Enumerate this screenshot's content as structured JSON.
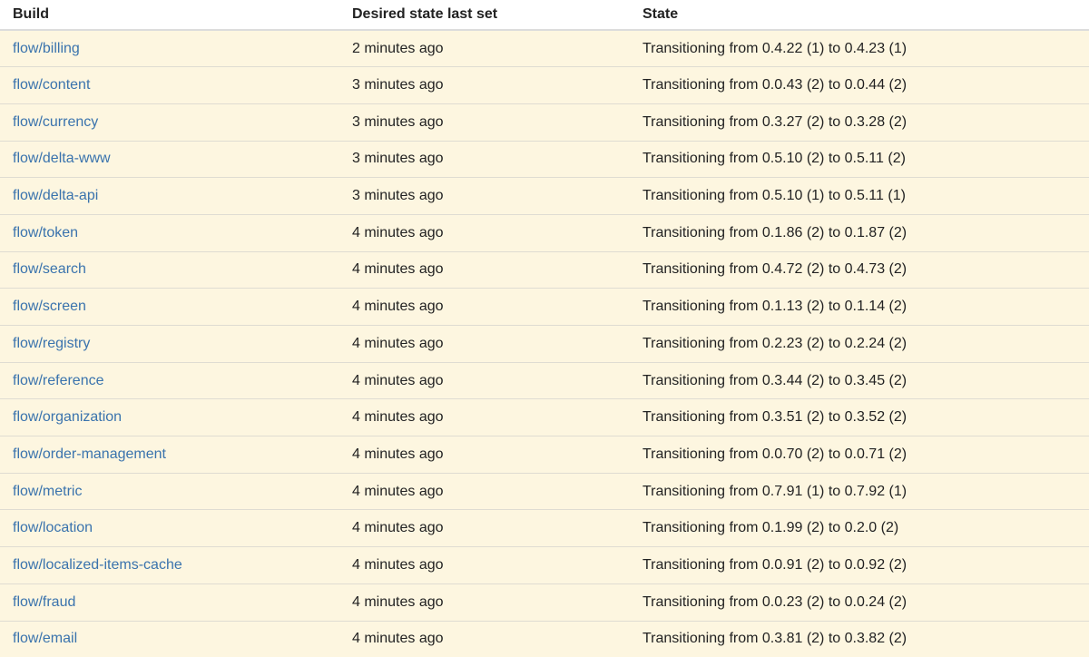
{
  "table": {
    "headers": {
      "build": "Build",
      "desired": "Desired state last set",
      "state": "State"
    },
    "rows": [
      {
        "build": "flow/billing",
        "desired": "2 minutes ago",
        "state": "Transitioning from 0.4.22 (1) to 0.4.23 (1)"
      },
      {
        "build": "flow/content",
        "desired": "3 minutes ago",
        "state": "Transitioning from 0.0.43 (2) to 0.0.44 (2)"
      },
      {
        "build": "flow/currency",
        "desired": "3 minutes ago",
        "state": "Transitioning from 0.3.27 (2) to 0.3.28 (2)"
      },
      {
        "build": "flow/delta-www",
        "desired": "3 minutes ago",
        "state": "Transitioning from 0.5.10 (2) to 0.5.11 (2)"
      },
      {
        "build": "flow/delta-api",
        "desired": "3 minutes ago",
        "state": "Transitioning from 0.5.10 (1) to 0.5.11 (1)"
      },
      {
        "build": "flow/token",
        "desired": "4 minutes ago",
        "state": "Transitioning from 0.1.86 (2) to 0.1.87 (2)"
      },
      {
        "build": "flow/search",
        "desired": "4 minutes ago",
        "state": "Transitioning from 0.4.72 (2) to 0.4.73 (2)"
      },
      {
        "build": "flow/screen",
        "desired": "4 minutes ago",
        "state": "Transitioning from 0.1.13 (2) to 0.1.14 (2)"
      },
      {
        "build": "flow/registry",
        "desired": "4 minutes ago",
        "state": "Transitioning from 0.2.23 (2) to 0.2.24 (2)"
      },
      {
        "build": "flow/reference",
        "desired": "4 minutes ago",
        "state": "Transitioning from 0.3.44 (2) to 0.3.45 (2)"
      },
      {
        "build": "flow/organization",
        "desired": "4 minutes ago",
        "state": "Transitioning from 0.3.51 (2) to 0.3.52 (2)"
      },
      {
        "build": "flow/order-management",
        "desired": "4 minutes ago",
        "state": "Transitioning from 0.0.70 (2) to 0.0.71 (2)"
      },
      {
        "build": "flow/metric",
        "desired": "4 minutes ago",
        "state": "Transitioning from 0.7.91 (1) to 0.7.92 (1)"
      },
      {
        "build": "flow/location",
        "desired": "4 minutes ago",
        "state": "Transitioning from 0.1.99 (2) to 0.2.0 (2)"
      },
      {
        "build": "flow/localized-items-cache",
        "desired": "4 minutes ago",
        "state": "Transitioning from 0.0.91 (2) to 0.0.92 (2)"
      },
      {
        "build": "flow/fraud",
        "desired": "4 minutes ago",
        "state": "Transitioning from 0.0.23 (2) to 0.0.24 (2)"
      },
      {
        "build": "flow/email",
        "desired": "4 minutes ago",
        "state": "Transitioning from 0.3.81 (2) to 0.3.82 (2)"
      }
    ]
  },
  "colors": {
    "row_background": "#fdf6e0",
    "link": "#3a73ad",
    "text": "#222222",
    "header_rule": "#dcdcdc",
    "row_rule": "#dfdcd2"
  }
}
